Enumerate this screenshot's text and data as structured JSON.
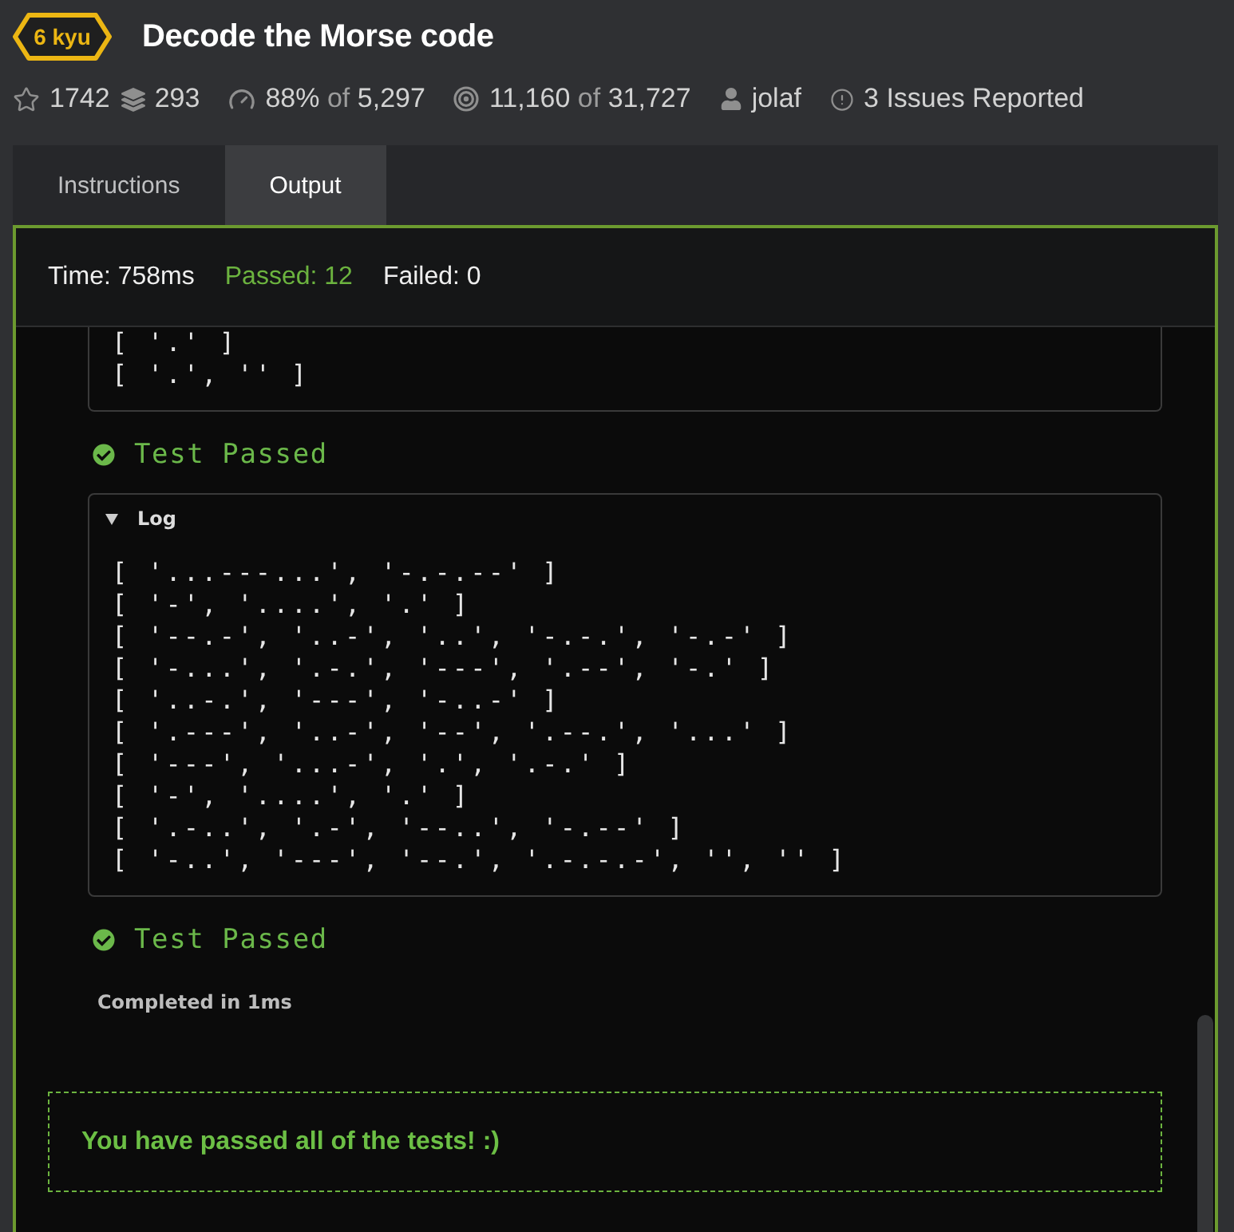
{
  "kata": {
    "rank": "6 kyu",
    "title": "Decode the Morse code"
  },
  "stats": [
    {
      "kind": "stars",
      "value": "1742"
    },
    {
      "kind": "collections",
      "value": "293"
    },
    {
      "kind": "satisfaction",
      "value": "88%",
      "joiner": "of",
      "total": "5,297"
    },
    {
      "kind": "completions",
      "value": "11,160",
      "joiner": "of",
      "total": "31,727"
    },
    {
      "kind": "author",
      "value": "jolaf"
    },
    {
      "kind": "issues",
      "value": "3 Issues Reported"
    }
  ],
  "tabs": [
    {
      "label": "Instructions",
      "selected": false
    },
    {
      "label": "Output",
      "selected": true
    }
  ],
  "summary": [
    {
      "kind": "time",
      "text": "Time: 758ms"
    },
    {
      "kind": "passed",
      "text": "Passed: 12"
    },
    {
      "kind": "failed",
      "text": "Failed: 0"
    }
  ],
  "output": [
    {
      "kind": "log",
      "lines": [
        "[ '.' ]",
        "[ '.', '' ]"
      ]
    },
    {
      "kind": "passed",
      "text": "Test Passed"
    },
    {
      "kind": "log",
      "title": "Log",
      "expanded": true,
      "lines": [
        "[ '...---...', '-.-.--' ]",
        "[ '-', '....', '.' ]",
        "[ '--.-', '..-', '..', '-.-.', '-.-' ]",
        "[ '-...', '.-.', '---', '.--', '-.' ]",
        "[ '..-.', '---', '-..-' ]",
        "[ '.---', '..-', '--', '.--.', '...' ]",
        "[ '---', '...-', '.', '.-.' ]",
        "[ '-', '....', '.' ]",
        "[ '.-..', '.-', '--..', '-.--' ]",
        "[ '-..', '---', '--.', '.-.-.-', '', '' ]"
      ]
    },
    {
      "kind": "passed",
      "text": "Test Passed"
    },
    {
      "kind": "completed",
      "text": "Completed in 1ms"
    }
  ],
  "result_message": "You have passed all of the tests! :)"
}
